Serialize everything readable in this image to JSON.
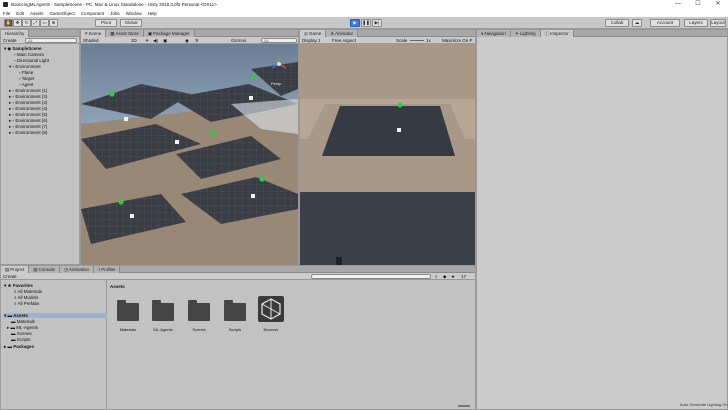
{
  "window": {
    "title": "BouncingMLAgents - SampleScene - PC, Mac & Linux Standalone - Unity 2018.3.0f2 Personal <DX11>",
    "minimize": "—",
    "maximize": "☐",
    "close": "✕"
  },
  "menu": [
    "File",
    "Edit",
    "Assets",
    "GameObject",
    "Component",
    "Jobs",
    "Window",
    "Help"
  ],
  "toolbar": {
    "pivot": "Pivot",
    "global": "Global",
    "play_icon": "play-icon",
    "collab": "Collab",
    "account": "Account",
    "layers": "Layers",
    "layout": "Layout"
  },
  "hierarchy": {
    "tab": "Hierarchy",
    "create": "Create",
    "search_placeholder": "All",
    "scene": "SampleScene",
    "items": [
      {
        "label": "Main Camera",
        "depth": 2
      },
      {
        "label": "Directional Light",
        "depth": 2
      },
      {
        "label": "Environment",
        "depth": 1
      },
      {
        "label": "Plane",
        "depth": 3
      },
      {
        "label": "Target",
        "depth": 3
      },
      {
        "label": "Agent",
        "depth": 3
      },
      {
        "label": "Environment (1)",
        "depth": 1
      },
      {
        "label": "Environment (2)",
        "depth": 1
      },
      {
        "label": "Environment (3)",
        "depth": 1
      },
      {
        "label": "Environment (4)",
        "depth": 1
      },
      {
        "label": "Environment (5)",
        "depth": 1
      },
      {
        "label": "Environment (6)",
        "depth": 1
      },
      {
        "label": "Environment (7)",
        "depth": 1
      },
      {
        "label": "Environment (8)",
        "depth": 1
      }
    ]
  },
  "scene": {
    "tabs": [
      "Scene",
      "Asset Store",
      "Package Manager"
    ],
    "shading": "Shaded",
    "mode2d": "2D",
    "gizmos": "Gizmos",
    "search_placeholder": "All",
    "persp": "Persp"
  },
  "game": {
    "tabs": [
      "Game",
      "Animator"
    ],
    "display": "Display 1",
    "aspect": "Free Aspect",
    "scale_label": "Scale",
    "scale_value": "1x",
    "maximize": "Maximize On P"
  },
  "inspector": {
    "tabs": [
      "Navigation",
      "Lighting",
      "Inspector"
    ]
  },
  "project": {
    "tabs": [
      "Project",
      "Console",
      "Animation",
      "Profiler"
    ],
    "create": "Create",
    "count": "17",
    "favorites_label": "Favorites",
    "favorites": [
      "All Materials",
      "All Models",
      "All Prefabs"
    ],
    "assets_label": "Assets",
    "asset_children": [
      "Materials",
      "ML-Agents",
      "Scenes",
      "Scripts"
    ],
    "packages_label": "Packages",
    "breadcrumb": "Assets",
    "grid_items": [
      "Materials",
      "ML-Agents",
      "Scenes",
      "Scripts",
      "Bouncer"
    ],
    "status": "Auto Generate Lighting On"
  }
}
